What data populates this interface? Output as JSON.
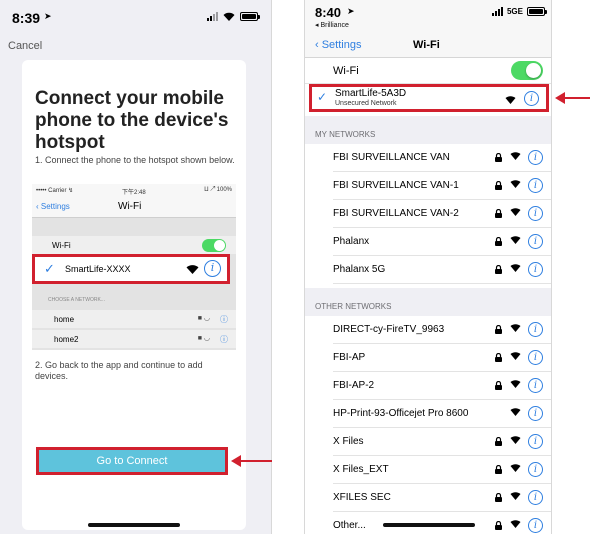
{
  "left": {
    "status_time": "8:39",
    "cancel_label": "Cancel",
    "heading": "Connect your mobile phone to the device's hotspot",
    "step1": "1. Connect the phone to the hotspot shown below.",
    "step2": "2. Go back to the app and continue to add devices.",
    "go_button": "Go to Connect",
    "mini": {
      "carrier": "••••• Carrier ↯",
      "clock": "下午2:48",
      "battery": "⨿ ↗ 100%",
      "back_label": "‹ Settings",
      "title": "Wi-Fi",
      "wifi_label": "Wi-Fi",
      "selected_network": "SmartLife-XXXX",
      "choose_header": "CHOOSE A NETWORK...",
      "networks": [
        "home",
        "home2"
      ]
    }
  },
  "right": {
    "status_time": "8:40",
    "back_app": "◂ Brilliance",
    "network_type": "5GE",
    "back_label": "‹ Settings",
    "title": "Wi-Fi",
    "wifi_label": "Wi-Fi",
    "connected": {
      "name": "SmartLife-5A3D",
      "subtitle": "Unsecured Network"
    },
    "my_networks_header": "MY NETWORKS",
    "my_networks": [
      "FBI SURVEILLANCE VAN",
      "FBI SURVEILLANCE VAN-1",
      "FBI SURVEILLANCE VAN-2",
      "Phalanx",
      "Phalanx 5G"
    ],
    "other_networks_header": "OTHER NETWORKS",
    "other_networks": [
      "DIRECT-cy-FireTV_9963",
      "FBI-AP",
      "FBI-AP-2",
      "HP-Print-93-Officejet Pro 8600",
      "X Files",
      "X Files_EXT",
      "XFILES SEC",
      "Other..."
    ]
  },
  "icons": {
    "check": "✓",
    "wifi": "◠",
    "lock": "🔒",
    "info": "i"
  },
  "colors": {
    "highlight": "#d1202e",
    "ios_blue": "#2f7fe0",
    "toggle_green": "#4cd964",
    "connect_button": "#5ec3dc"
  }
}
